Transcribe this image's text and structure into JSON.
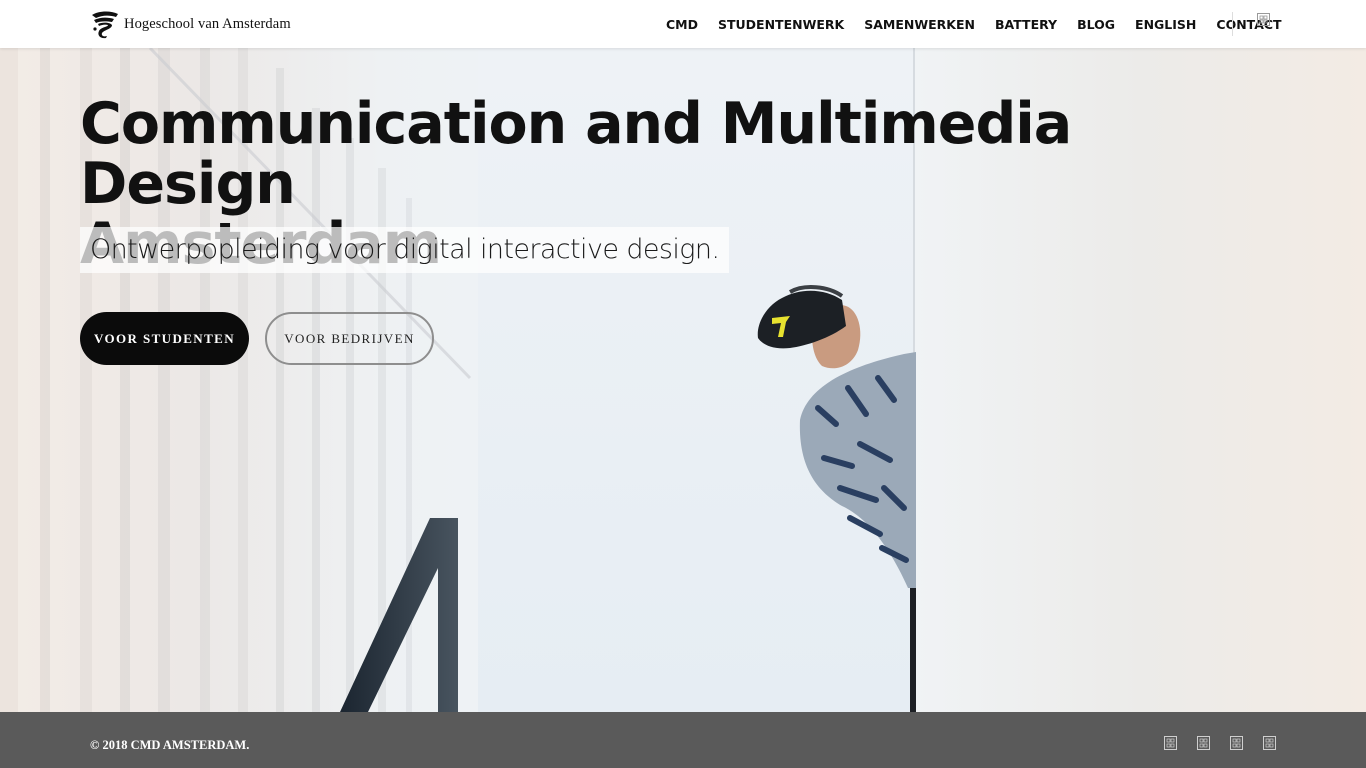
{
  "header": {
    "logo_text": "Hogeschool van Amsterdam",
    "logo_icon": "hva-logo-mark",
    "nav": [
      {
        "label": "CMD"
      },
      {
        "label": "STUDENTENWERK"
      },
      {
        "label": "SAMENWERKEN"
      },
      {
        "label": "BATTERY"
      },
      {
        "label": "BLOG"
      },
      {
        "label": "ENGLISH"
      },
      {
        "label": "CONTACT"
      }
    ],
    "search_icon": "search-icon"
  },
  "hero": {
    "title_line1": "Communication and Multimedia Design",
    "title_line2": "Amsterdam",
    "subtitle": "Ontwerpopleiding voor digital interactive design.",
    "primary_button": "VOOR STUDENTEN",
    "secondary_button": "VOOR BEDRIJVEN",
    "image_subject": "vr-headset-person-photo"
  },
  "footer": {
    "copyright": "© 2018 CMD AMSTERDAM.",
    "social_icons": [
      "social-icon-1",
      "social-icon-2",
      "social-icon-3",
      "social-icon-4"
    ]
  },
  "colors": {
    "text": "#111111",
    "button_primary_bg": "#0b0b0b",
    "footer_bg": "#5a5a5a",
    "header_bg": "#ffffff"
  }
}
